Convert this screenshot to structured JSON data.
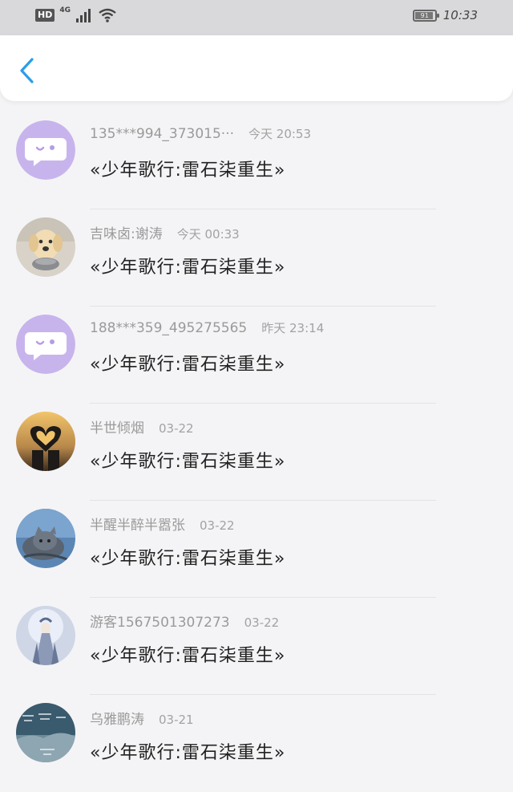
{
  "status_bar": {
    "hd": "HD",
    "network": "4G",
    "battery": "91",
    "battery_level": 0.91,
    "time": "10:33"
  },
  "header": {
    "back_icon": "chevron-left-icon",
    "accent": "#2a9ee8"
  },
  "items": [
    {
      "user": "135***994_373015···",
      "time": "今天 20:53",
      "title": "«少年歌行:雷石柒重生»",
      "avatar": "chat-bubble-avatar"
    },
    {
      "user": "吉味卤:谢涛",
      "time": "今天 00:33",
      "title": "«少年歌行:雷石柒重生»",
      "avatar": "dog-photo-avatar"
    },
    {
      "user": "188***359_495275565",
      "time": "昨天 23:14",
      "title": "«少年歌行:雷石柒重生»",
      "avatar": "chat-bubble-avatar"
    },
    {
      "user": "半世倾烟",
      "time": "03-22",
      "title": "«少年歌行:雷石柒重生»",
      "avatar": "heart-hands-photo-avatar"
    },
    {
      "user": "半醒半醉半嚣张",
      "time": "03-22",
      "title": "«少年歌行:雷石柒重生»",
      "avatar": "cat-photo-avatar"
    },
    {
      "user": "游客1567501307273",
      "time": "03-22",
      "title": "«少年歌行:雷石柒重生»",
      "avatar": "fantasy-figure-avatar"
    },
    {
      "user": "乌雅鹏涛",
      "time": "03-21",
      "title": "«少年歌行:雷石柒重生»",
      "avatar": "calligraphy-landscape-avatar"
    }
  ]
}
